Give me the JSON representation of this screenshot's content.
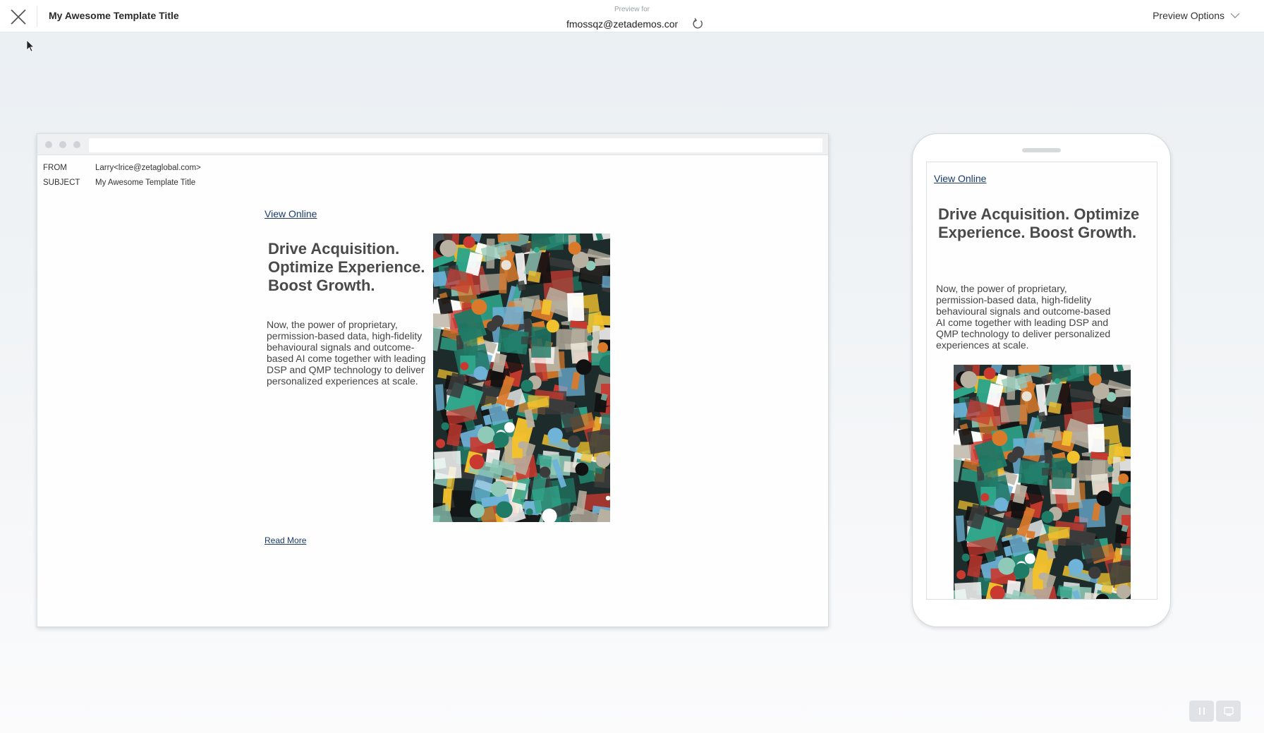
{
  "topbar": {
    "template_title": "My Awesome Template Title",
    "preview_for_label": "Preview for",
    "preview_email": "fmossqz@zetademos.com",
    "preview_options_label": "Preview Options"
  },
  "desktop": {
    "email_headers": {
      "from_key": "FROM",
      "from_value": "Larry<lrice@zetaglobal.com>",
      "subject_key": "SUBJECT",
      "subject_value": "My Awesome Template Title"
    },
    "view_online": "View Online",
    "headline": "Drive Acquisition. Optimize Experience. Boost Growth.",
    "paragraph": "Now, the power of proprietary, permission-based data, high-fidelity behavioural signals and outcome-based AI come together with leading DSP and QMP technology to deliver personalized experiences at scale.",
    "read_more": "Read More"
  },
  "mobile": {
    "view_online": "View Online",
    "headline": "Drive Acquisition. Optimize Experience. Boost Growth.",
    "paragraph": "Now, the power of proprietary, permission-based data, high-fidelity behavioural signals and outcome-based AI come together with leading DSP and QMP technology to deliver personalized experiences at scale."
  },
  "icons": {
    "close": "close-icon",
    "refresh": "refresh-icon",
    "preview_options": "chevron-down-icon",
    "pause": "pause-icon",
    "device": "device-icon"
  },
  "colors": {
    "link": "#1a3a6b",
    "headline": "#4a4a4a",
    "collage_teal": "#2fa58a"
  }
}
